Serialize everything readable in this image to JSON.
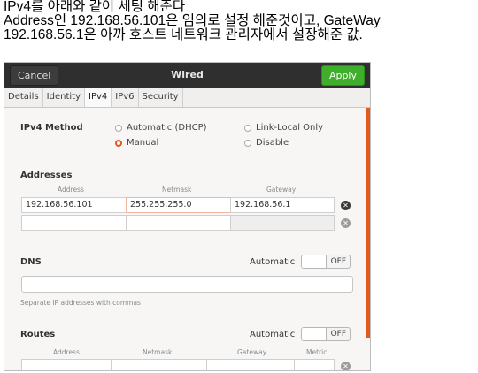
{
  "annotation": {
    "line1": "IPv4를 아래와 같이 세팅 해준다",
    "line2": "Address인 192.168.56.101은 임의로 설정 해준것이고, GateWay",
    "line3": "192.168.56.1은 아까 호스트 네트워크 관리자에서 설장해준 값."
  },
  "window": {
    "cancel_label": "Cancel",
    "title": "Wired",
    "apply_label": "Apply",
    "accent_color": "#e2571e",
    "apply_color": "#3fae2a"
  },
  "tabs": [
    {
      "label": "Details"
    },
    {
      "label": "Identity"
    },
    {
      "label": "IPv4"
    },
    {
      "label": "IPv6"
    },
    {
      "label": "Security"
    }
  ],
  "active_tab": "IPv4",
  "ipv4": {
    "method_label": "IPv4 Method",
    "options": {
      "automatic": "Automatic (DHCP)",
      "link_local": "Link-Local Only",
      "manual": "Manual",
      "disable": "Disable"
    },
    "selected": "Manual",
    "addresses": {
      "label": "Addresses",
      "columns": {
        "address": "Address",
        "netmask": "Netmask",
        "gateway": "Gateway"
      },
      "row": {
        "address": "192.168.56.101",
        "netmask": "255.255.255.0",
        "gateway": "192.168.56.1"
      }
    },
    "dns": {
      "label": "DNS",
      "automatic_label": "Automatic",
      "toggle_label": "OFF",
      "hint": "Separate IP addresses with commas"
    },
    "routes": {
      "label": "Routes",
      "automatic_label": "Automatic",
      "toggle_label": "OFF",
      "columns": {
        "address": "Address",
        "netmask": "Netmask",
        "gateway": "Gateway",
        "metric": "Metric"
      }
    }
  }
}
